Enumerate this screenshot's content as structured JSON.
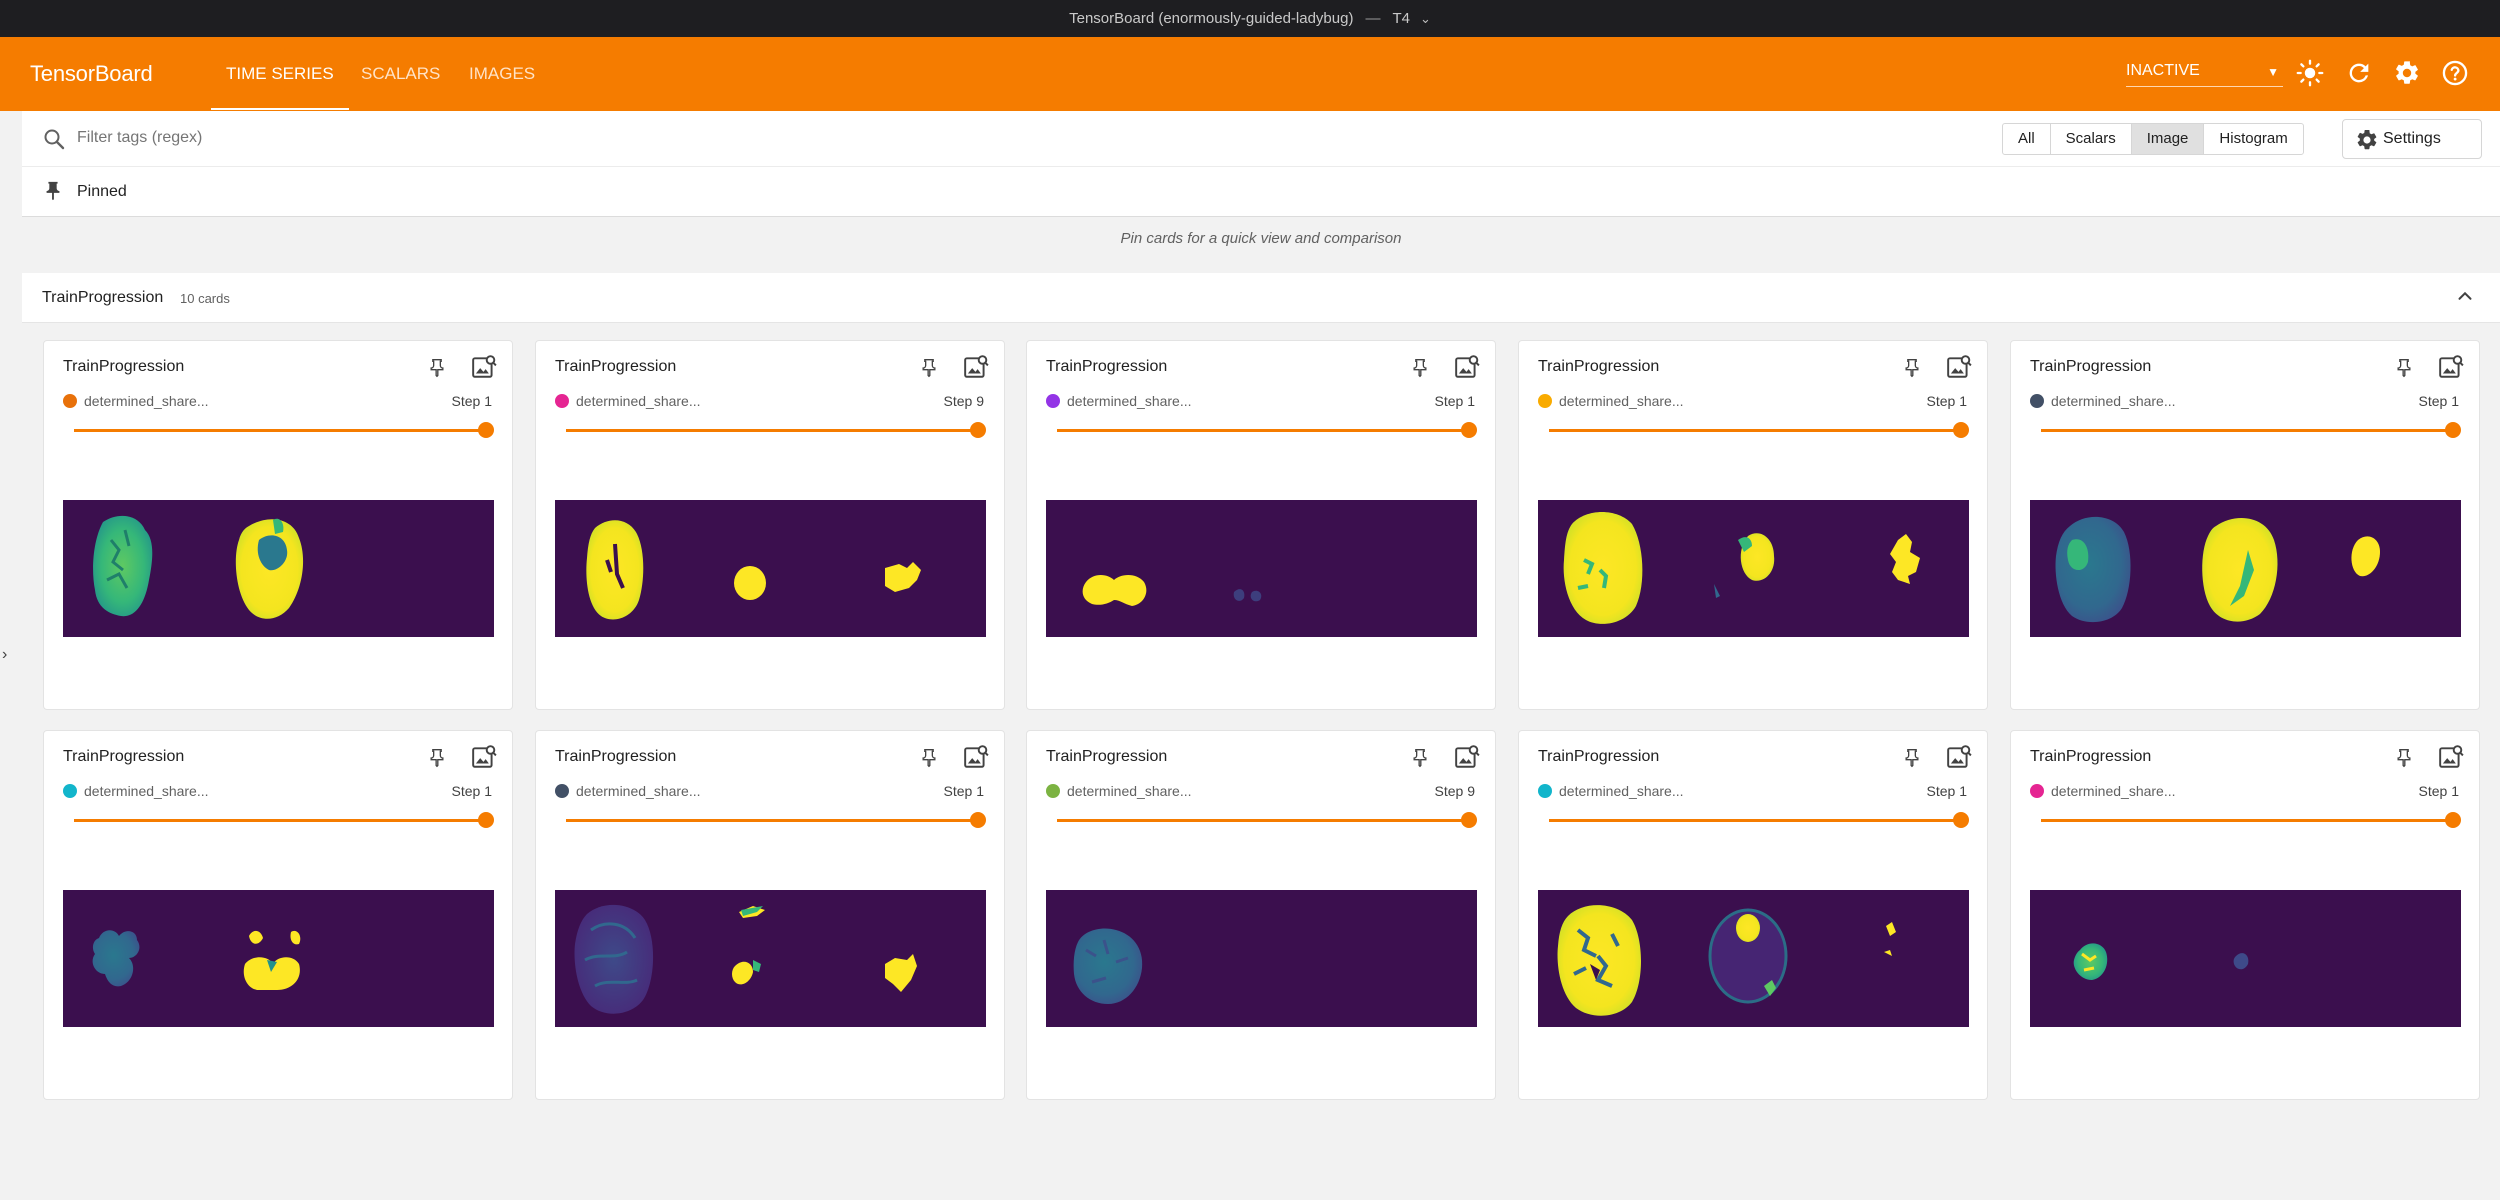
{
  "window": {
    "title": "TensorBoard (enormously-guided-ladybug)",
    "separator": "—",
    "instance": "T4"
  },
  "header": {
    "brand": "TensorBoard",
    "tabs": [
      {
        "label": "TIME SERIES",
        "active": true
      },
      {
        "label": "SCALARS",
        "active": false
      },
      {
        "label": "IMAGES",
        "active": false
      }
    ],
    "status": "INACTIVE",
    "icons": [
      "brightness-icon",
      "refresh-icon",
      "settings-icon",
      "help-icon"
    ]
  },
  "filter": {
    "placeholder": "Filter tags (regex)",
    "types": [
      {
        "label": "All",
        "selected": false
      },
      {
        "label": "Scalars",
        "selected": false
      },
      {
        "label": "Image",
        "selected": true
      },
      {
        "label": "Histogram",
        "selected": false
      }
    ],
    "settings_label": "Settings"
  },
  "pinned": {
    "label": "Pinned",
    "hint": "Pin cards for a quick view and comparison"
  },
  "group": {
    "name": "TrainProgression",
    "count": "10 cards"
  },
  "colors": {
    "accent": "#f57c00",
    "image_bg": "#3b0f4e"
  },
  "cards": [
    {
      "title": "TrainProgression",
      "run": "determined_share...",
      "run_color": "#e8710a",
      "step": "Step 1",
      "slider": 1.0,
      "img": "a"
    },
    {
      "title": "TrainProgression",
      "run": "determined_share...",
      "run_color": "#e52592",
      "step": "Step 9",
      "slider": 1.0,
      "img": "b"
    },
    {
      "title": "TrainProgression",
      "run": "determined_share...",
      "run_color": "#9334e6",
      "step": "Step 1",
      "slider": 1.0,
      "img": "c"
    },
    {
      "title": "TrainProgression",
      "run": "determined_share...",
      "run_color": "#f9ab00",
      "step": "Step 1",
      "slider": 1.0,
      "img": "d"
    },
    {
      "title": "TrainProgression",
      "run": "determined_share...",
      "run_color": "#425066",
      "step": "Step 1",
      "slider": 1.0,
      "img": "e"
    },
    {
      "title": "TrainProgression",
      "run": "determined_share...",
      "run_color": "#12b5cb",
      "step": "Step 1",
      "slider": 1.0,
      "img": "f"
    },
    {
      "title": "TrainProgression",
      "run": "determined_share...",
      "run_color": "#425066",
      "step": "Step 1",
      "slider": 1.0,
      "img": "g"
    },
    {
      "title": "TrainProgression",
      "run": "determined_share...",
      "run_color": "#7cb342",
      "step": "Step 9",
      "slider": 1.0,
      "img": "h"
    },
    {
      "title": "TrainProgression",
      "run": "determined_share...",
      "run_color": "#12b5cb",
      "step": "Step 1",
      "slider": 1.0,
      "img": "i"
    },
    {
      "title": "TrainProgression",
      "run": "determined_share...",
      "run_color": "#e52592",
      "step": "Step 1",
      "slider": 1.0,
      "img": "j"
    }
  ]
}
